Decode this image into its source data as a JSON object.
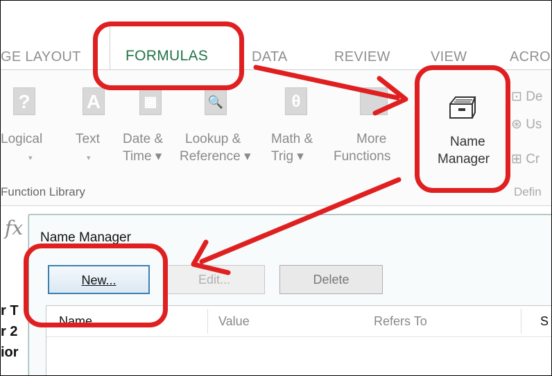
{
  "ribbon_tabs": [
    {
      "label": "GE LAYOUT",
      "active": false
    },
    {
      "label": "FORMULAS",
      "active": true
    },
    {
      "label": "DATA",
      "active": false
    },
    {
      "label": "REVIEW",
      "active": false
    },
    {
      "label": "VIEW",
      "active": false
    },
    {
      "label": "ACRO",
      "active": false
    }
  ],
  "ribbon": {
    "buttons": [
      {
        "icon": "logical-icon",
        "glyph": "?",
        "line1": "Logical",
        "line2": "▾"
      },
      {
        "icon": "text-icon",
        "glyph": "A",
        "line1": "Text",
        "line2": "▾"
      },
      {
        "icon": "date-time-icon",
        "glyph": "▦",
        "line1": "Date &",
        "line2": "Time ▾"
      },
      {
        "icon": "lookup-reference-icon",
        "glyph": "🔍",
        "line1": "Lookup &",
        "line2": "Reference ▾"
      },
      {
        "icon": "math-trig-icon",
        "glyph": "θ",
        "line1": "Math &",
        "line2": "Trig ▾"
      },
      {
        "icon": "more-functions-icon",
        "glyph": "",
        "line1": "More",
        "line2": "Functions"
      }
    ],
    "name_manager": {
      "line1": "Name",
      "line2": "Manager",
      "icon": "name-manager-icon"
    },
    "side_items": [
      "De",
      "Us",
      "Cr"
    ],
    "group_function_library": "Function Library",
    "group_defined_names": "Defin"
  },
  "sheet": {
    "fx": "fx",
    "row_fragments": [
      "r T",
      "r 2",
      "ior"
    ]
  },
  "dialog": {
    "title": "Name Manager",
    "new_button": "New...",
    "edit_button": "Edit...",
    "delete_button": "Delete",
    "columns": [
      "Name",
      "Value",
      "Refers To",
      "S"
    ]
  },
  "colors": {
    "accent_green": "#217346",
    "annotation_red": "#e02020",
    "primary_button_border": "#3c7fb1"
  }
}
